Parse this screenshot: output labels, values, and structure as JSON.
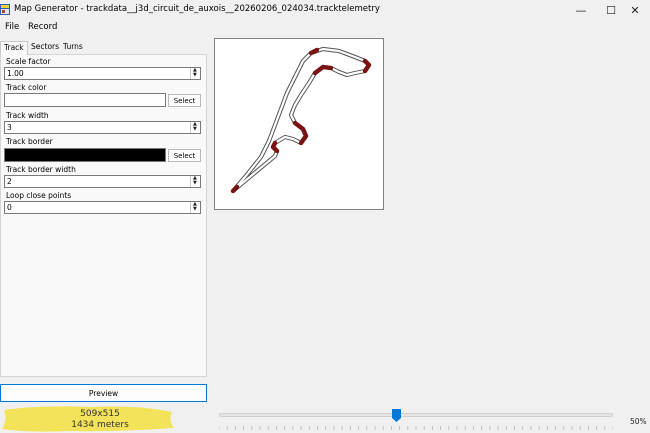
{
  "window": {
    "title": "Map Generator - trackdata__j3d_circuit_de_auxois__20260206_024034.tracktelemetry",
    "minimize_glyph": "—",
    "maximize_glyph": "☐",
    "close_glyph": "✕"
  },
  "menu": {
    "file": "File",
    "record": "Record"
  },
  "tabs": [
    {
      "label": "Track",
      "selected": true
    },
    {
      "label": "Sectors",
      "selected": false
    },
    {
      "label": "Turns",
      "selected": false
    }
  ],
  "track_tab": {
    "scale_factor": {
      "label": "Scale factor",
      "value": "1.00"
    },
    "track_color": {
      "label": "Track color",
      "color": "#ffffff",
      "button": "Select"
    },
    "track_width": {
      "label": "Track width",
      "value": "3"
    },
    "track_border": {
      "label": "Track border",
      "color": "#000000",
      "button": "Select"
    },
    "track_border_width": {
      "label": "Track border width",
      "value": "2"
    },
    "loop_close_points": {
      "label": "Loop close points",
      "value": "0"
    }
  },
  "preview_button": "Preview",
  "stats": {
    "size": "509x515",
    "length": "1434 meters"
  },
  "zoom": {
    "label": "50%",
    "fraction": 0.45
  },
  "colors": {
    "accent": "#0078d7",
    "highlight": "#f2e35a",
    "sector_red": "#7a1414"
  },
  "icons": {
    "app": "map-generator-app-icon",
    "spinner": "spin-arrows-icon",
    "slider_thumb": "slider-thumb-icon"
  }
}
